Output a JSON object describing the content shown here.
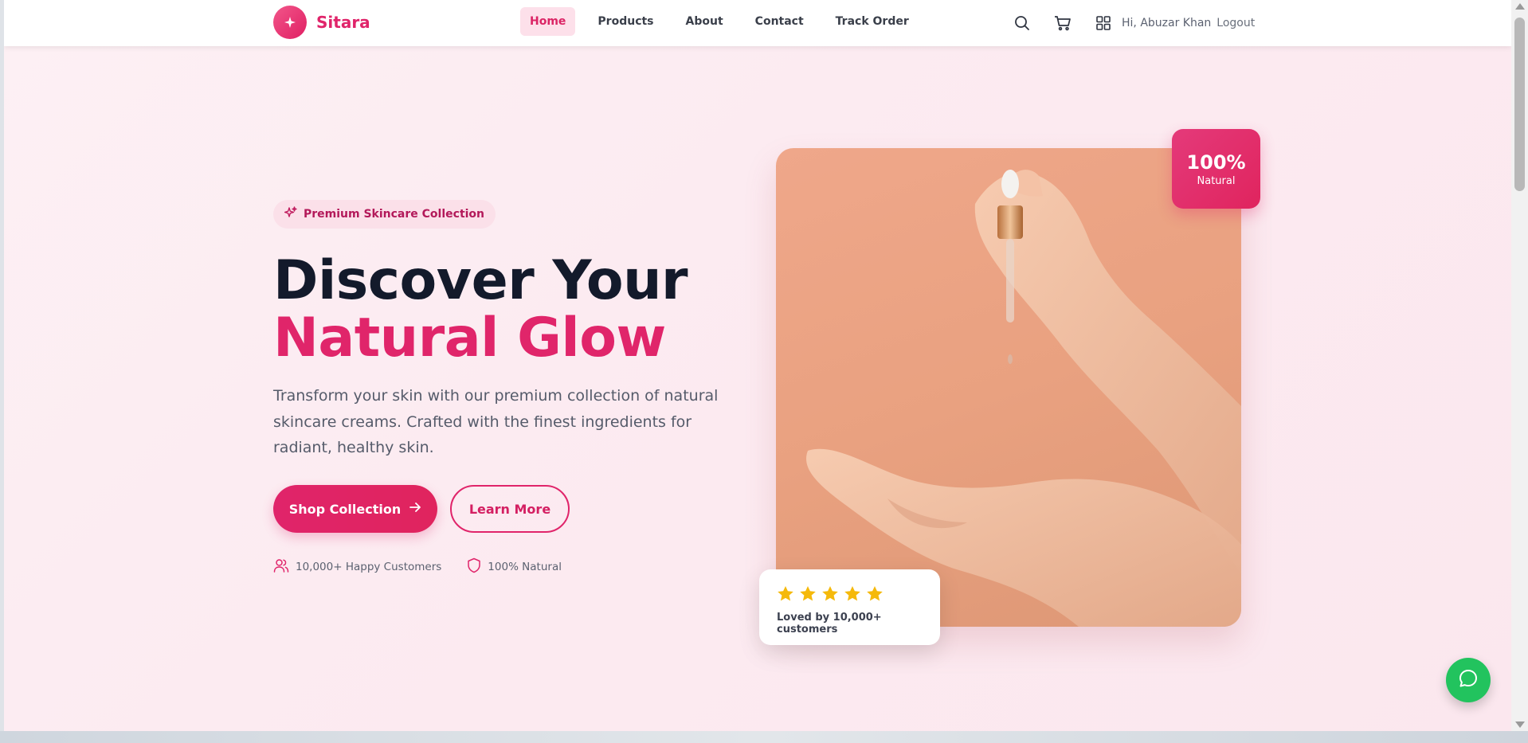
{
  "brand": {
    "name": "Sitara",
    "color": "#e0246a"
  },
  "nav": {
    "items": [
      {
        "label": "Home",
        "active": true
      },
      {
        "label": "Products",
        "active": false
      },
      {
        "label": "About",
        "active": false
      },
      {
        "label": "Contact",
        "active": false
      },
      {
        "label": "Track Order",
        "active": false
      }
    ]
  },
  "header": {
    "icons": [
      "search-icon",
      "cart-icon",
      "grid-icon"
    ],
    "greeting": "Hi, Abuzar Khan",
    "logout_label": "Logout"
  },
  "hero": {
    "badge": "Premium Skincare Collection",
    "title_line1": "Discover Your",
    "title_line2": "Natural Glow",
    "description": "Transform your skin with our premium collection of natural skincare creams. Crafted with the finest ingredients for radiant, healthy skin.",
    "primary_button": "Shop Collection",
    "secondary_button": "Learn More",
    "stats": [
      {
        "icon": "users-icon",
        "label": "10,000+ Happy Customers"
      },
      {
        "icon": "shield-icon",
        "label": "100% Natural"
      }
    ]
  },
  "image_badge": {
    "value": "100%",
    "label": "Natural"
  },
  "rating_card": {
    "stars": 5,
    "text": "Loved by 10,000+ customers"
  },
  "chat": {
    "icon": "chat-icon",
    "color": "#22c35e"
  }
}
